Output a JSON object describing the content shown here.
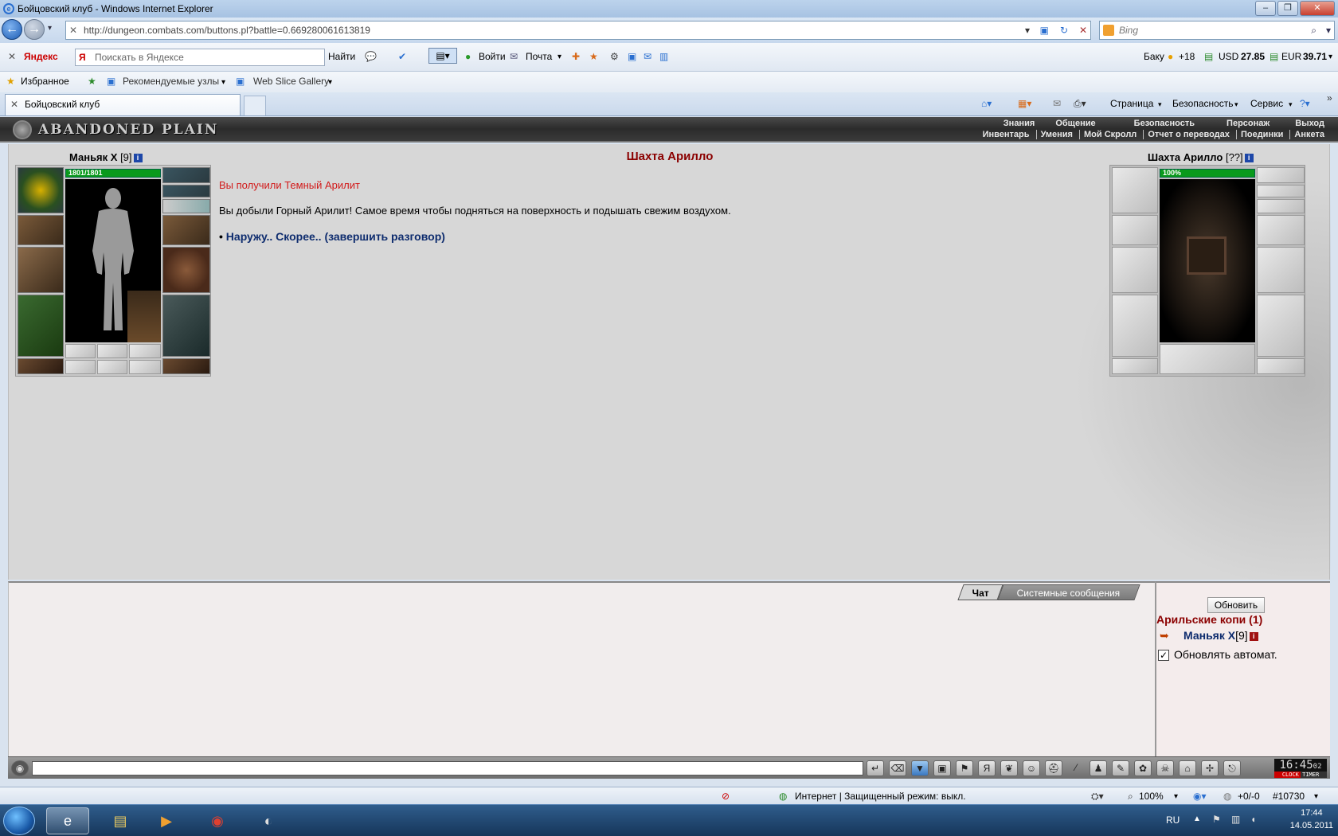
{
  "window": {
    "title": "Бойцовский клуб - Windows Internet Explorer"
  },
  "nav": {
    "address": "http://dungeon.combats.com/buttons.pl?battle=0.669280061613819",
    "search_placeholder": "Bing"
  },
  "yandex": {
    "brand": "Яндекс",
    "search_placeholder": "Поискать в Яндексе",
    "find_label": "Найти",
    "login_label": "Войти",
    "mail_label": "Почта",
    "weather": "Баку",
    "temp": "+18",
    "usd_label": "USD",
    "usd_value": "27.85",
    "eur_label": "EUR",
    "eur_value": "39.71"
  },
  "favorites": {
    "fav_label": "Избранное",
    "suggested": "Рекомендуемые узлы",
    "gallery": "Web Slice Gallery"
  },
  "tabs": {
    "active": "Бойцовский клуб"
  },
  "commands": {
    "page": "Страница",
    "security": "Безопасность",
    "service": "Сервис"
  },
  "game": {
    "logo": "ABANDONED PLAIN",
    "menu_top": [
      "Знания",
      "Общение",
      "Безопасность",
      "Персонаж",
      "Выход"
    ],
    "menu_bottom": [
      "Инвентарь",
      "Умения",
      "Мой Скролл",
      "Отчет о переводах",
      "Поединки",
      "Анкета"
    ]
  },
  "player": {
    "name": "Маньяк X",
    "level": "[9]",
    "hp": "1801/1801"
  },
  "npc": {
    "name": "Шахта Арилло",
    "level": "[??]",
    "hp": "100%"
  },
  "dialog": {
    "title": "Шахта Арилло",
    "received": "Вы получили Темный Арилит",
    "message": "Вы добыли Горный Арилит! Самое время чтобы подняться на поверхность и подышать свежим воздухом.",
    "bullet": "•",
    "action": "Наружу.. Скорее.. (завершить разговор)"
  },
  "chat": {
    "tab_chat": "Чат",
    "tab_system": "Системные сообщения"
  },
  "side": {
    "refresh": "Обновить",
    "location": "Арильские копи (1)",
    "user_name": "Маньяк X",
    "user_level": "[9]",
    "auto_label": "Обновлять автомат.",
    "auto_checked": true
  },
  "clock": {
    "time": "16:45",
    "sec": "02",
    "label": "CLOCK TIMER"
  },
  "status": {
    "zone": "Интернет | Защищенный режим: выкл.",
    "zoom": "100%",
    "counter1": "+0/-0",
    "counter2": "#10730"
  },
  "taskbar": {
    "lang": "RU",
    "time": "17:44",
    "date": "14.05.2011"
  },
  "colors": {
    "accent": "#8b0000",
    "link": "#0e2c6e",
    "alert": "#d21a1a",
    "hp_green": "#0a9a1c"
  }
}
